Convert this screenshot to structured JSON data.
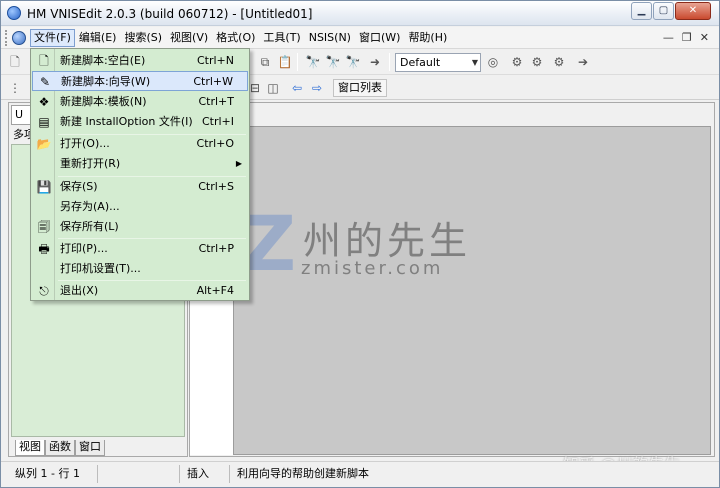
{
  "window": {
    "title": "HM VNISEdit 2.0.3 (build 060712) - [Untitled01]"
  },
  "menubar": {
    "items": [
      "文件(F)",
      "编辑(E)",
      "搜索(S)",
      "视图(V)",
      "格式(O)",
      "工具(T)",
      "NSIS(N)",
      "窗口(W)",
      "帮助(H)"
    ],
    "active_index": 0
  },
  "toolbar": {
    "combo_value": "Default",
    "window_list_label": "窗口列表"
  },
  "left_panel": {
    "top_tab": "U",
    "header": "多项",
    "bottom_tabs": [
      "视图",
      "函数",
      "窗口"
    ]
  },
  "file_menu": {
    "items": [
      {
        "label": "新建脚本:空白(E)",
        "shortcut": "Ctrl+N",
        "icon": "new-file-icon"
      },
      {
        "label": "新建脚本:向导(W)",
        "shortcut": "Ctrl+W",
        "icon": "wizard-icon",
        "highlighted": true
      },
      {
        "label": "新建脚本:模板(N)",
        "shortcut": "Ctrl+T",
        "icon": "template-icon"
      },
      {
        "label": "新建 InstallOption 文件(I)",
        "shortcut": "Ctrl+I",
        "icon": "installoption-icon"
      },
      {
        "label": "打开(O)...",
        "shortcut": "Ctrl+O",
        "icon": "open-folder-icon"
      },
      {
        "label": "重新打开(R)",
        "shortcut": "",
        "icon": "",
        "submenu": true
      },
      {
        "label": "保存(S)",
        "shortcut": "Ctrl+S",
        "icon": "save-icon"
      },
      {
        "label": "另存为(A)...",
        "shortcut": "",
        "icon": ""
      },
      {
        "label": "保存所有(L)",
        "shortcut": "",
        "icon": "save-all-icon"
      },
      {
        "label": "打印(P)...",
        "shortcut": "Ctrl+P",
        "icon": "print-icon"
      },
      {
        "label": "打印机设置(T)...",
        "shortcut": "",
        "icon": ""
      },
      {
        "label": "退出(X)",
        "shortcut": "Alt+F4",
        "icon": "exit-icon"
      }
    ]
  },
  "statusbar": {
    "position": "纵列 1 - 行 1",
    "mode": "插入",
    "message": "利用向导的帮助创建新脚本"
  },
  "watermark": {
    "cn": "州的先生",
    "en": "zmister.com",
    "zhihu": "知乎 @州的先生"
  },
  "colors": {
    "menu_bg": "#d4ecd1",
    "highlight": "#dbe8fb",
    "editor_bg": "#c8c8c8"
  }
}
